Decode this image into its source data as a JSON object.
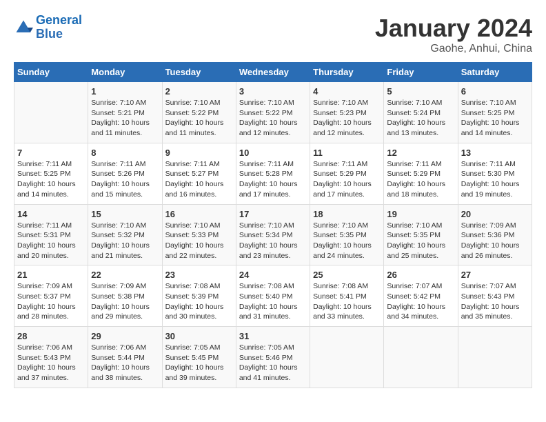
{
  "logo": {
    "line1": "General",
    "line2": "Blue"
  },
  "title": "January 2024",
  "subtitle": "Gaohe, Anhui, China",
  "days_header": [
    "Sunday",
    "Monday",
    "Tuesday",
    "Wednesday",
    "Thursday",
    "Friday",
    "Saturday"
  ],
  "weeks": [
    [
      {
        "day": "",
        "sunrise": "",
        "sunset": "",
        "daylight": ""
      },
      {
        "day": "1",
        "sunrise": "Sunrise: 7:10 AM",
        "sunset": "Sunset: 5:21 PM",
        "daylight": "Daylight: 10 hours and 11 minutes."
      },
      {
        "day": "2",
        "sunrise": "Sunrise: 7:10 AM",
        "sunset": "Sunset: 5:22 PM",
        "daylight": "Daylight: 10 hours and 11 minutes."
      },
      {
        "day": "3",
        "sunrise": "Sunrise: 7:10 AM",
        "sunset": "Sunset: 5:22 PM",
        "daylight": "Daylight: 10 hours and 12 minutes."
      },
      {
        "day": "4",
        "sunrise": "Sunrise: 7:10 AM",
        "sunset": "Sunset: 5:23 PM",
        "daylight": "Daylight: 10 hours and 12 minutes."
      },
      {
        "day": "5",
        "sunrise": "Sunrise: 7:10 AM",
        "sunset": "Sunset: 5:24 PM",
        "daylight": "Daylight: 10 hours and 13 minutes."
      },
      {
        "day": "6",
        "sunrise": "Sunrise: 7:10 AM",
        "sunset": "Sunset: 5:25 PM",
        "daylight": "Daylight: 10 hours and 14 minutes."
      }
    ],
    [
      {
        "day": "7",
        "sunrise": "Sunrise: 7:11 AM",
        "sunset": "Sunset: 5:25 PM",
        "daylight": "Daylight: 10 hours and 14 minutes."
      },
      {
        "day": "8",
        "sunrise": "Sunrise: 7:11 AM",
        "sunset": "Sunset: 5:26 PM",
        "daylight": "Daylight: 10 hours and 15 minutes."
      },
      {
        "day": "9",
        "sunrise": "Sunrise: 7:11 AM",
        "sunset": "Sunset: 5:27 PM",
        "daylight": "Daylight: 10 hours and 16 minutes."
      },
      {
        "day": "10",
        "sunrise": "Sunrise: 7:11 AM",
        "sunset": "Sunset: 5:28 PM",
        "daylight": "Daylight: 10 hours and 17 minutes."
      },
      {
        "day": "11",
        "sunrise": "Sunrise: 7:11 AM",
        "sunset": "Sunset: 5:29 PM",
        "daylight": "Daylight: 10 hours and 17 minutes."
      },
      {
        "day": "12",
        "sunrise": "Sunrise: 7:11 AM",
        "sunset": "Sunset: 5:29 PM",
        "daylight": "Daylight: 10 hours and 18 minutes."
      },
      {
        "day": "13",
        "sunrise": "Sunrise: 7:11 AM",
        "sunset": "Sunset: 5:30 PM",
        "daylight": "Daylight: 10 hours and 19 minutes."
      }
    ],
    [
      {
        "day": "14",
        "sunrise": "Sunrise: 7:11 AM",
        "sunset": "Sunset: 5:31 PM",
        "daylight": "Daylight: 10 hours and 20 minutes."
      },
      {
        "day": "15",
        "sunrise": "Sunrise: 7:10 AM",
        "sunset": "Sunset: 5:32 PM",
        "daylight": "Daylight: 10 hours and 21 minutes."
      },
      {
        "day": "16",
        "sunrise": "Sunrise: 7:10 AM",
        "sunset": "Sunset: 5:33 PM",
        "daylight": "Daylight: 10 hours and 22 minutes."
      },
      {
        "day": "17",
        "sunrise": "Sunrise: 7:10 AM",
        "sunset": "Sunset: 5:34 PM",
        "daylight": "Daylight: 10 hours and 23 minutes."
      },
      {
        "day": "18",
        "sunrise": "Sunrise: 7:10 AM",
        "sunset": "Sunset: 5:35 PM",
        "daylight": "Daylight: 10 hours and 24 minutes."
      },
      {
        "day": "19",
        "sunrise": "Sunrise: 7:10 AM",
        "sunset": "Sunset: 5:35 PM",
        "daylight": "Daylight: 10 hours and 25 minutes."
      },
      {
        "day": "20",
        "sunrise": "Sunrise: 7:09 AM",
        "sunset": "Sunset: 5:36 PM",
        "daylight": "Daylight: 10 hours and 26 minutes."
      }
    ],
    [
      {
        "day": "21",
        "sunrise": "Sunrise: 7:09 AM",
        "sunset": "Sunset: 5:37 PM",
        "daylight": "Daylight: 10 hours and 28 minutes."
      },
      {
        "day": "22",
        "sunrise": "Sunrise: 7:09 AM",
        "sunset": "Sunset: 5:38 PM",
        "daylight": "Daylight: 10 hours and 29 minutes."
      },
      {
        "day": "23",
        "sunrise": "Sunrise: 7:08 AM",
        "sunset": "Sunset: 5:39 PM",
        "daylight": "Daylight: 10 hours and 30 minutes."
      },
      {
        "day": "24",
        "sunrise": "Sunrise: 7:08 AM",
        "sunset": "Sunset: 5:40 PM",
        "daylight": "Daylight: 10 hours and 31 minutes."
      },
      {
        "day": "25",
        "sunrise": "Sunrise: 7:08 AM",
        "sunset": "Sunset: 5:41 PM",
        "daylight": "Daylight: 10 hours and 33 minutes."
      },
      {
        "day": "26",
        "sunrise": "Sunrise: 7:07 AM",
        "sunset": "Sunset: 5:42 PM",
        "daylight": "Daylight: 10 hours and 34 minutes."
      },
      {
        "day": "27",
        "sunrise": "Sunrise: 7:07 AM",
        "sunset": "Sunset: 5:43 PM",
        "daylight": "Daylight: 10 hours and 35 minutes."
      }
    ],
    [
      {
        "day": "28",
        "sunrise": "Sunrise: 7:06 AM",
        "sunset": "Sunset: 5:43 PM",
        "daylight": "Daylight: 10 hours and 37 minutes."
      },
      {
        "day": "29",
        "sunrise": "Sunrise: 7:06 AM",
        "sunset": "Sunset: 5:44 PM",
        "daylight": "Daylight: 10 hours and 38 minutes."
      },
      {
        "day": "30",
        "sunrise": "Sunrise: 7:05 AM",
        "sunset": "Sunset: 5:45 PM",
        "daylight": "Daylight: 10 hours and 39 minutes."
      },
      {
        "day": "31",
        "sunrise": "Sunrise: 7:05 AM",
        "sunset": "Sunset: 5:46 PM",
        "daylight": "Daylight: 10 hours and 41 minutes."
      },
      {
        "day": "",
        "sunrise": "",
        "sunset": "",
        "daylight": ""
      },
      {
        "day": "",
        "sunrise": "",
        "sunset": "",
        "daylight": ""
      },
      {
        "day": "",
        "sunrise": "",
        "sunset": "",
        "daylight": ""
      }
    ]
  ]
}
